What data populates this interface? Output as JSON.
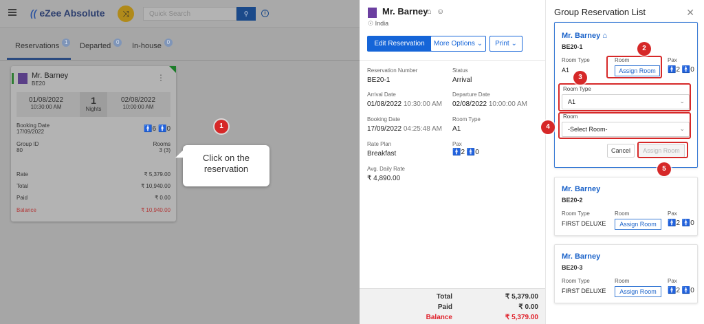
{
  "app": {
    "name": "eZee Absolute",
    "search_placeholder": "Quick Search"
  },
  "tabs": [
    {
      "label": "Reservations",
      "count": "1"
    },
    {
      "label": "Departed",
      "count": "0"
    },
    {
      "label": "In-house",
      "count": "0"
    }
  ],
  "res_card": {
    "name": "Mr. Barney",
    "code": "BE20",
    "arrival_date": "01/08/2022",
    "arrival_time": "10:30:00 AM",
    "nights_value": "1",
    "nights_label": "Nights",
    "departure_date": "02/08/2022",
    "departure_time": "10:00:00 AM",
    "booking_date_label": "Booking Date",
    "booking_date": "17/09/2022",
    "pax_adult": "6",
    "pax_child": "0",
    "group_id_label": "Group ID",
    "group_id": "80",
    "rooms_label": "Rooms",
    "rooms": "3 (3)",
    "rate_label": "Rate",
    "rate": "₹ 5,379.00",
    "total_label": "Total",
    "total": "₹ 10,940.00",
    "paid_label": "Paid",
    "paid": "₹ 0.00",
    "balance_label": "Balance",
    "balance": "₹ 10,940.00"
  },
  "callout": {
    "line1": "Click on the",
    "line2": "reservation"
  },
  "steps": [
    "1",
    "2",
    "3",
    "4",
    "5"
  ],
  "detail": {
    "name": "Mr. Barney",
    "country": "India",
    "edit_btn": "Edit Reservation",
    "more_btn": "More Options",
    "print_btn": "Print",
    "fields": {
      "res_no_label": "Reservation Number",
      "res_no": "BE20-1",
      "status_label": "Status",
      "status": "Arrival",
      "arrival_label": "Arrival Date",
      "arrival_date": "01/08/2022",
      "arrival_time": "10:30:00 AM",
      "departure_label": "Departure Date",
      "departure_date": "02/08/2022",
      "departure_time": "10:00:00 AM",
      "booking_label": "Booking Date",
      "booking_date": "17/09/2022",
      "booking_time": "04:25:48 AM",
      "room_type_label": "Room Type",
      "room_type": "A1",
      "rate_plan_label": "Rate Plan",
      "rate_plan": "Breakfast",
      "pax_label": "Pax",
      "pax_adult": "2",
      "pax_child": "0",
      "adr_label": "Avg. Daily Rate",
      "adr": "₹ 4,890.00"
    },
    "footer": {
      "total_label": "Total",
      "total": "₹ 5,379.00",
      "paid_label": "Paid",
      "paid": "₹ 0.00",
      "balance_label": "Balance",
      "balance": "₹ 5,379.00"
    }
  },
  "group": {
    "title": "Group Reservation List",
    "cards": [
      {
        "name": "Mr. Barney",
        "code": "BE20-1",
        "room_type_label": "Room Type",
        "room_type": "A1",
        "room_label": "Room",
        "assign": "Assign Room",
        "pax_label": "Pax",
        "pax_adult": "2",
        "pax_child": "0",
        "form": {
          "room_type_label": "Room Type",
          "room_type_value": "A1",
          "room_label": "Room",
          "room_value": "-Select Room-",
          "cancel": "Cancel",
          "assign": "Assign Room"
        }
      },
      {
        "name": "Mr. Barney",
        "code": "BE20-2",
        "room_type_label": "Room Type",
        "room_type": "FIRST DELUXE",
        "room_label": "Room",
        "assign": "Assign Room",
        "pax_label": "Pax",
        "pax_adult": "2",
        "pax_child": "0"
      },
      {
        "name": "Mr. Barney",
        "code": "BE20-3",
        "room_type_label": "Room Type",
        "room_type": "FIRST DELUXE",
        "room_label": "Room",
        "assign": "Assign Room",
        "pax_label": "Pax",
        "pax_adult": "2",
        "pax_child": "0"
      }
    ]
  },
  "colors": {
    "primary": "#1565d8",
    "badge": "#d62828",
    "balance": "#e0202a",
    "link": "#1a62c9"
  }
}
